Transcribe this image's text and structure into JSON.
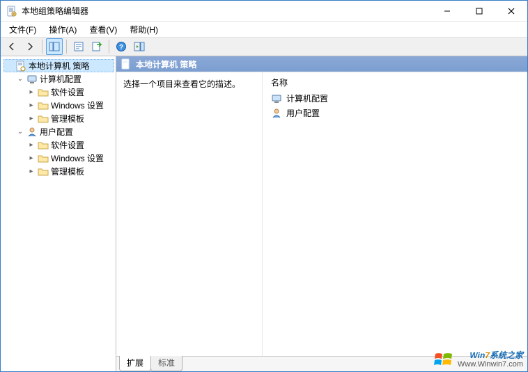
{
  "window": {
    "title": "本地组策略编辑器"
  },
  "menu": {
    "file": "文件(F)",
    "action": "操作(A)",
    "view": "查看(V)",
    "help": "帮助(H)"
  },
  "tree": {
    "root": "本地计算机 策略",
    "computer_config": "计算机配置",
    "user_config": "用户配置",
    "software_settings": "软件设置",
    "windows_settings": "Windows 设置",
    "admin_templates": "管理模板"
  },
  "content": {
    "header": "本地计算机 策略",
    "description_prompt": "选择一个项目来查看它的描述。",
    "column_name": "名称",
    "items": {
      "computer_config": "计算机配置",
      "user_config": "用户配置"
    }
  },
  "tabs": {
    "extended": "扩展",
    "standard": "标准"
  },
  "watermark": {
    "line1_a": "Win",
    "line1_b": "7",
    "line1_c": "系统之家",
    "line2": "Www.Winwin7.com"
  }
}
